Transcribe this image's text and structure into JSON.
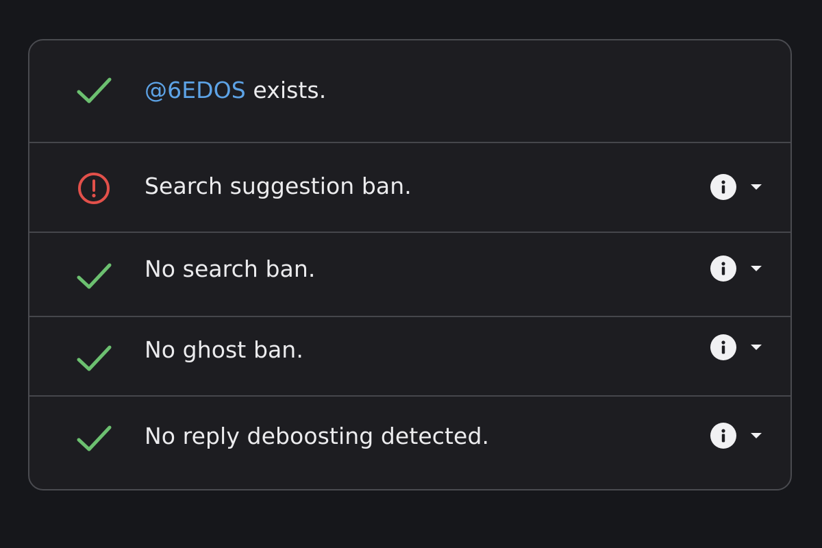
{
  "colors": {
    "background": "#16171b",
    "panel": "#1d1d21",
    "success": "#6cc070",
    "error": "#e2504a",
    "link": "#5da3e6",
    "text": "#ececee"
  },
  "results": [
    {
      "status": "success",
      "icon": "check-icon",
      "handle": "@6EDOS",
      "text": " exists.",
      "has_details": false
    },
    {
      "status": "error",
      "icon": "alert-circle-icon",
      "text": "Search suggestion ban.",
      "has_details": true
    },
    {
      "status": "success",
      "icon": "check-icon",
      "text": "No search ban.",
      "has_details": true
    },
    {
      "status": "success",
      "icon": "check-icon",
      "text": "No ghost ban.",
      "has_details": true
    },
    {
      "status": "success",
      "icon": "check-icon",
      "text": "No reply deboosting detected.",
      "has_details": true
    }
  ]
}
